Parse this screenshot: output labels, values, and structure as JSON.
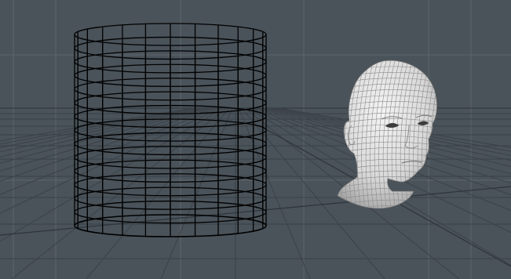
{
  "viewport": {
    "view": "perspective",
    "background_color": "#4a535a",
    "grid_color": "#5d666c",
    "ground_grid_color": "#3b4248",
    "horizon_line_color": "#2e3439"
  },
  "objects": [
    {
      "name": "cylinder",
      "display": "wireframe",
      "wire_color": "#000000",
      "vertical_segments": 24,
      "horizontal_rings": 14
    },
    {
      "name": "head",
      "display": "shaded-with-wireframe",
      "surface_color": "#dcdcdc",
      "wire_color": "#8c8c8c"
    }
  ]
}
